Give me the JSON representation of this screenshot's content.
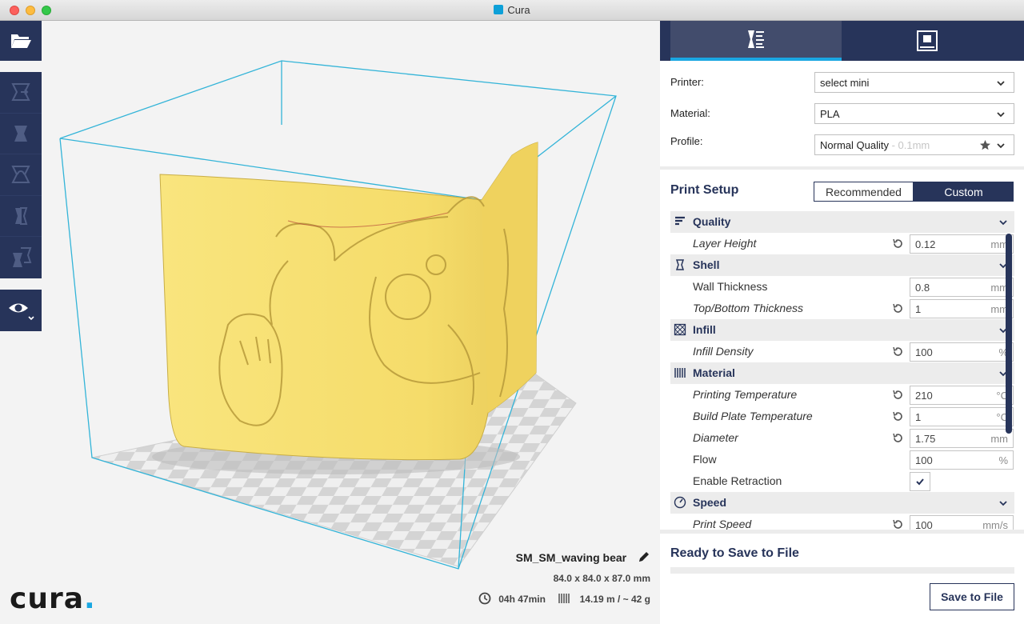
{
  "window": {
    "title": "Cura"
  },
  "toolbar": {
    "open_icon": "folder-open-icon",
    "tools": [
      "translate-icon",
      "scale-icon",
      "rotate-icon",
      "mirror-icon",
      "per-model-settings-icon"
    ],
    "view_icon": "eye-icon"
  },
  "logo": {
    "text": "cura",
    "dot": "."
  },
  "model": {
    "name": "SM_SM_waving bear",
    "dimensions": "84.0 x 84.0 x 87.0 mm",
    "time": "04h 47min",
    "material_usage": "14.19 m / ~ 42 g"
  },
  "tabs": {
    "prepare_icon": "prepare-icon",
    "monitor_icon": "monitor-icon"
  },
  "machine": {
    "printer_label": "Printer:",
    "printer_value": "select mini",
    "material_label": "Material:",
    "material_value": "PLA",
    "profile_label": "Profile:",
    "profile_value": "Normal Quality",
    "profile_sub": " - 0.1mm"
  },
  "print_setup": {
    "title": "Print Setup",
    "mode_recommended": "Recommended",
    "mode_custom": "Custom",
    "mode_selected": "Custom"
  },
  "settings": [
    {
      "type": "category",
      "name": "Quality",
      "icon": "quality-icon"
    },
    {
      "type": "setting",
      "name": "Layer Height",
      "value": "0.12",
      "unit": "mm",
      "italic": true,
      "reset": true
    },
    {
      "type": "category",
      "name": "Shell",
      "icon": "shell-icon"
    },
    {
      "type": "setting",
      "name": "Wall Thickness",
      "value": "0.8",
      "unit": "mm",
      "italic": false,
      "reset": false
    },
    {
      "type": "setting",
      "name": "Top/Bottom Thickness",
      "value": "1",
      "unit": "mm",
      "italic": true,
      "reset": true
    },
    {
      "type": "category",
      "name": "Infill",
      "icon": "infill-icon"
    },
    {
      "type": "setting",
      "name": "Infill Density",
      "value": "100",
      "unit": "%",
      "italic": true,
      "reset": true
    },
    {
      "type": "category",
      "name": "Material",
      "icon": "material-icon"
    },
    {
      "type": "setting",
      "name": "Printing Temperature",
      "value": "210",
      "unit": "°C",
      "italic": true,
      "reset": true
    },
    {
      "type": "setting",
      "name": "Build Plate Temperature",
      "value": "1",
      "unit": "°C",
      "italic": true,
      "reset": true
    },
    {
      "type": "setting",
      "name": "Diameter",
      "value": "1.75",
      "unit": "mm",
      "italic": true,
      "reset": true
    },
    {
      "type": "setting",
      "name": "Flow",
      "value": "100",
      "unit": "%",
      "italic": false,
      "reset": false
    },
    {
      "type": "checkbox",
      "name": "Enable Retraction",
      "checked": true
    },
    {
      "type": "category",
      "name": "Speed",
      "icon": "speed-icon"
    },
    {
      "type": "setting",
      "name": "Print Speed",
      "value": "100",
      "unit": "mm/s",
      "italic": true,
      "reset": true
    }
  ],
  "save": {
    "status": "Ready to Save to File",
    "progress": 0,
    "button": "Save to File"
  },
  "colors": {
    "accent": "#1aa7e2",
    "navy": "#27345a",
    "model": "#f7e27a"
  }
}
